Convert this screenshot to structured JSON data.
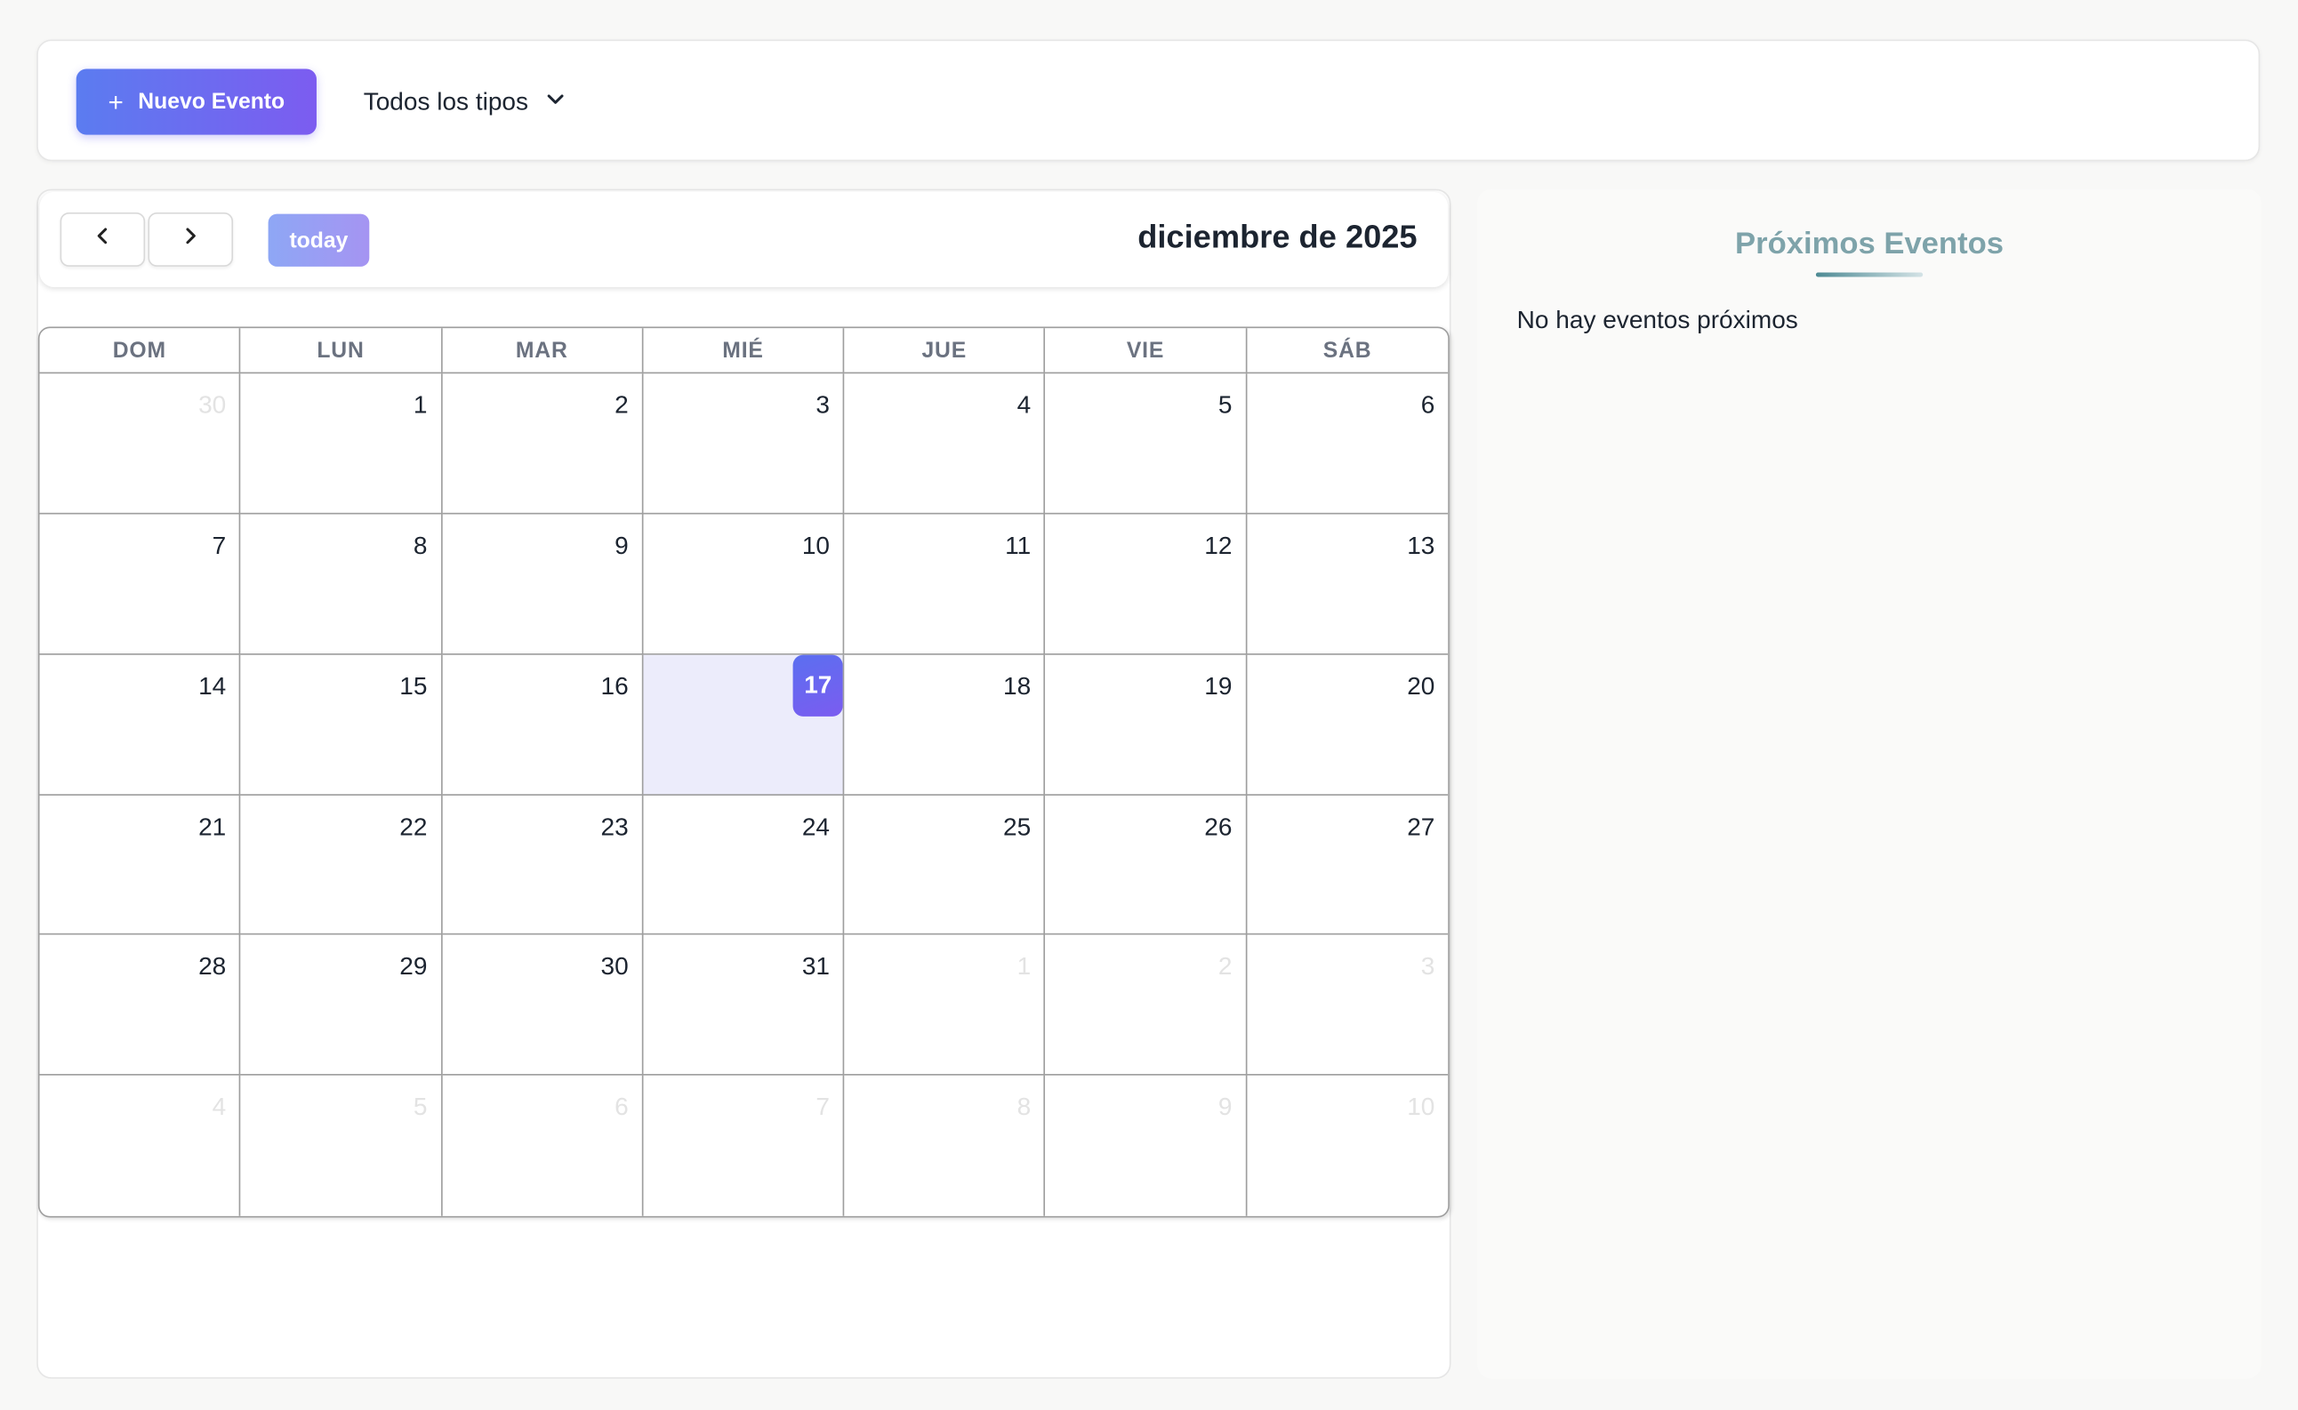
{
  "toolbar": {
    "new_event_label": "Nuevo Evento",
    "new_event_icon": "plus-icon",
    "type_filter_value": "Todos los tipos",
    "type_filter_icon": "chevron-down-icon"
  },
  "calendar": {
    "prev_icon": "chevron-left-icon",
    "next_icon": "chevron-right-icon",
    "today_label": "today",
    "title": "diciembre de 2025",
    "weekdays": [
      "DOM",
      "LUN",
      "MAR",
      "MIÉ",
      "JUE",
      "VIE",
      "SÁB"
    ],
    "today_date": "17",
    "weeks": [
      [
        {
          "d": "30",
          "other": true
        },
        {
          "d": "1"
        },
        {
          "d": "2"
        },
        {
          "d": "3"
        },
        {
          "d": "4"
        },
        {
          "d": "5"
        },
        {
          "d": "6"
        }
      ],
      [
        {
          "d": "7"
        },
        {
          "d": "8"
        },
        {
          "d": "9"
        },
        {
          "d": "10"
        },
        {
          "d": "11"
        },
        {
          "d": "12"
        },
        {
          "d": "13"
        }
      ],
      [
        {
          "d": "14"
        },
        {
          "d": "15"
        },
        {
          "d": "16"
        },
        {
          "d": "17",
          "today": true
        },
        {
          "d": "18"
        },
        {
          "d": "19"
        },
        {
          "d": "20"
        }
      ],
      [
        {
          "d": "21"
        },
        {
          "d": "22"
        },
        {
          "d": "23"
        },
        {
          "d": "24"
        },
        {
          "d": "25"
        },
        {
          "d": "26"
        },
        {
          "d": "27"
        }
      ],
      [
        {
          "d": "28"
        },
        {
          "d": "29"
        },
        {
          "d": "30"
        },
        {
          "d": "31"
        },
        {
          "d": "1",
          "other": true
        },
        {
          "d": "2",
          "other": true
        },
        {
          "d": "3",
          "other": true
        }
      ],
      [
        {
          "d": "4",
          "other": true
        },
        {
          "d": "5",
          "other": true
        },
        {
          "d": "6",
          "other": true
        },
        {
          "d": "7",
          "other": true
        },
        {
          "d": "8",
          "other": true
        },
        {
          "d": "9",
          "other": true
        },
        {
          "d": "10",
          "other": true
        }
      ]
    ]
  },
  "upcoming": {
    "title": "Próximos Eventos",
    "empty_message": "No hay eventos próximos"
  },
  "colors": {
    "accent_start": "#5b7cf0",
    "accent_end": "#7c5cf0",
    "today_bg": "#ececfb",
    "side_title": "#7ea3aa"
  }
}
